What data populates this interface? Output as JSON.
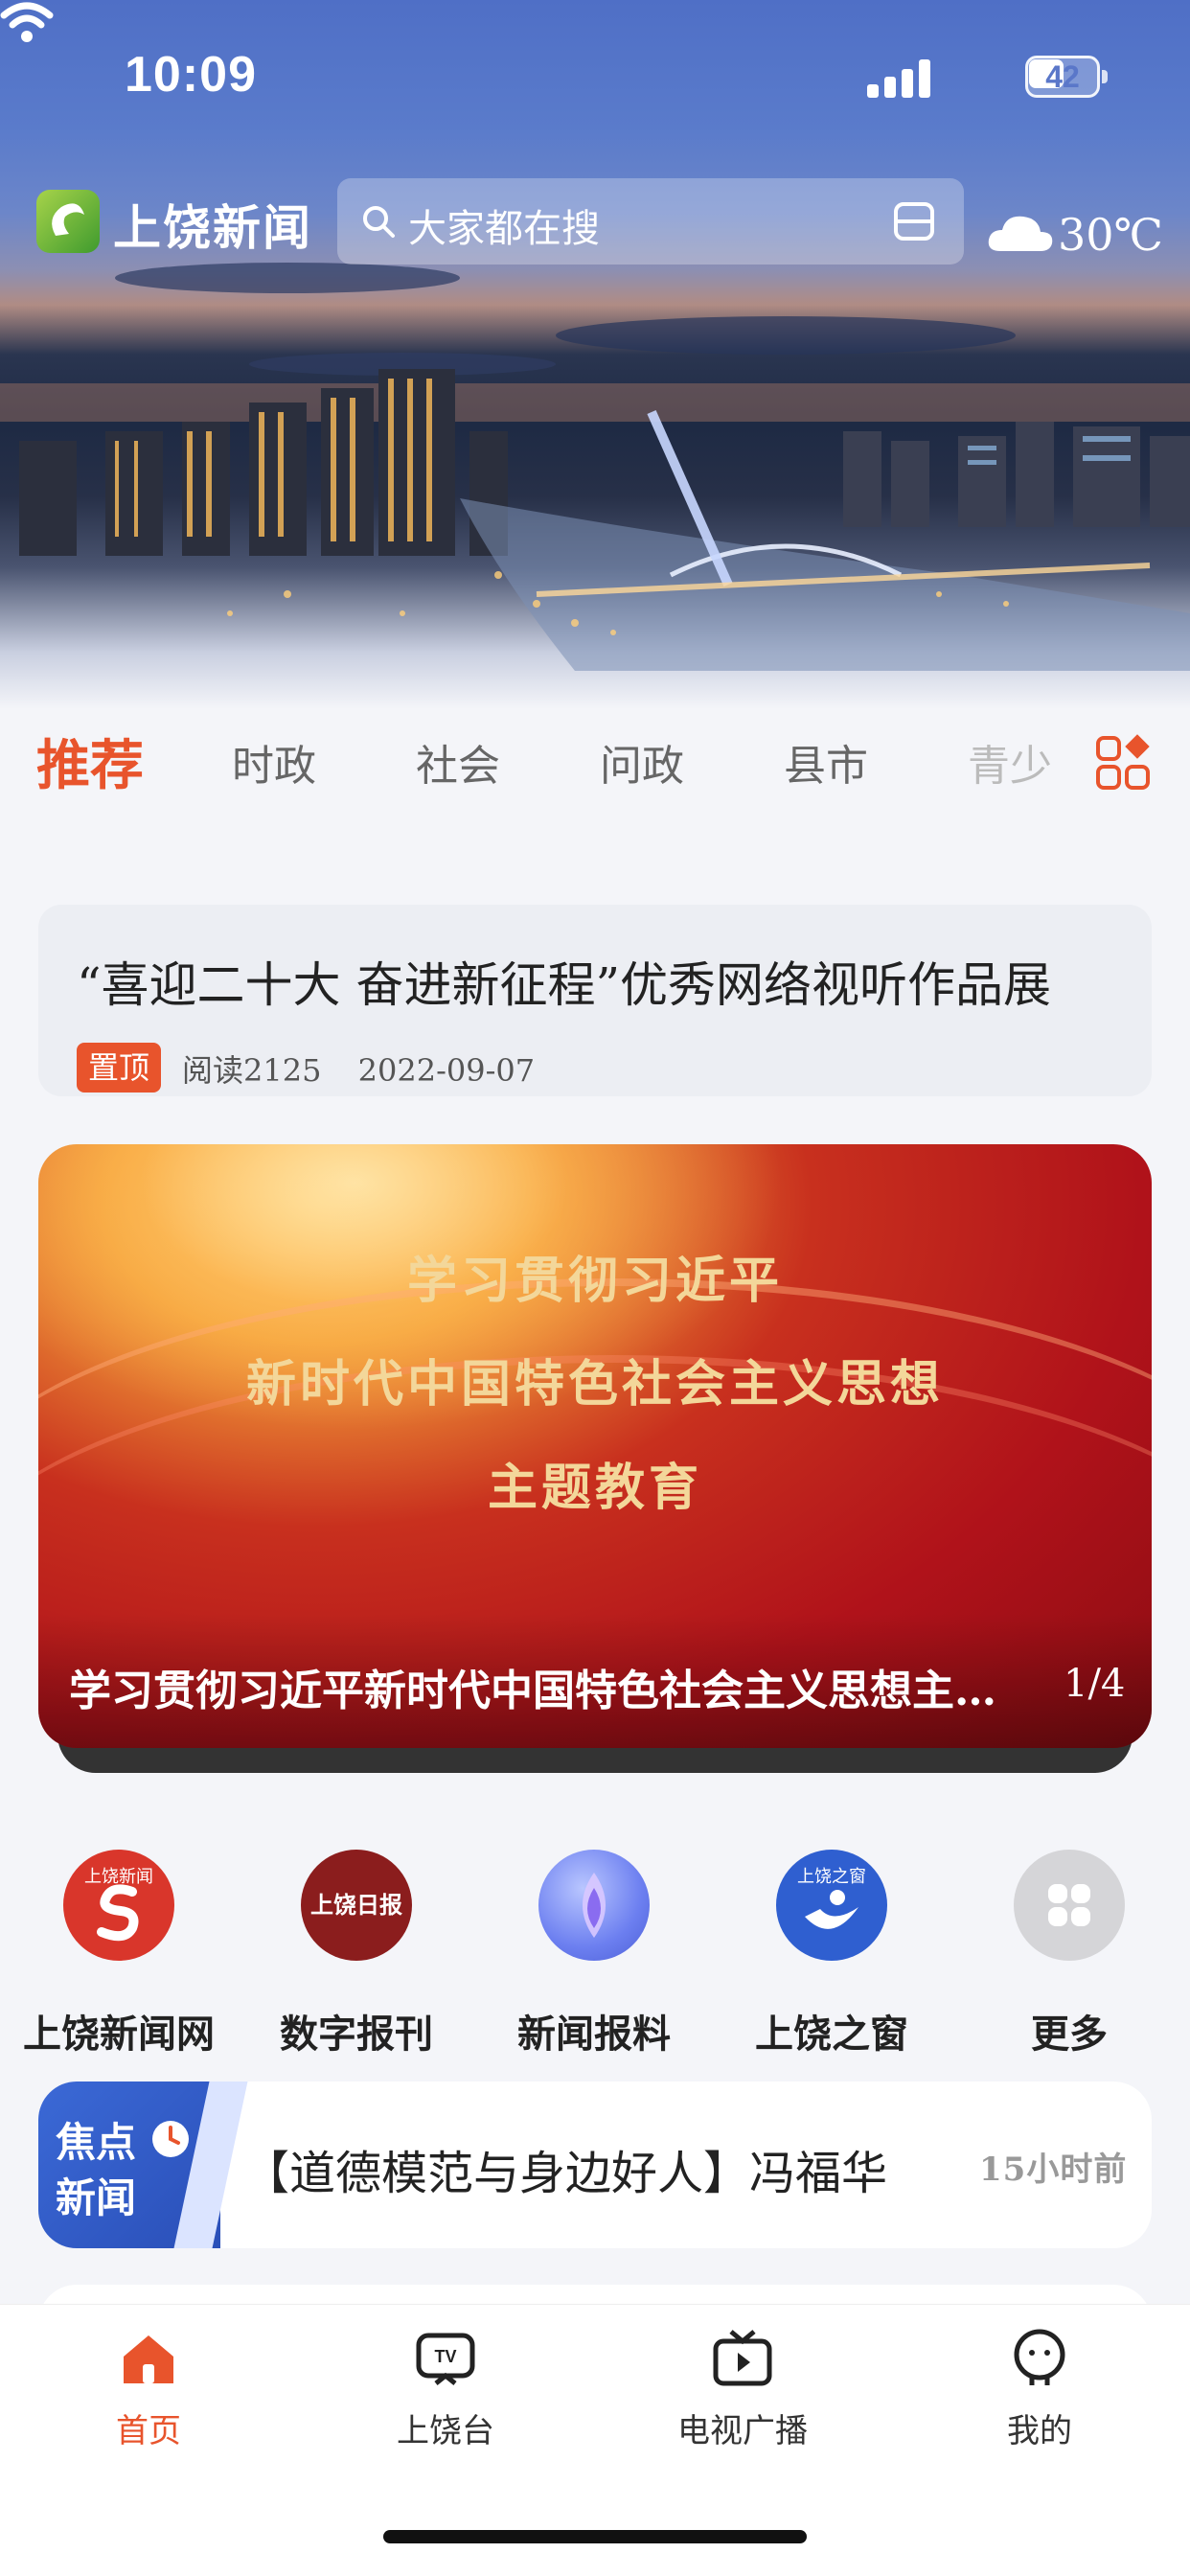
{
  "status_bar": {
    "time": "10:09",
    "battery": "42"
  },
  "header": {
    "app_name": "上饶新闻",
    "search_placeholder": "大家都在搜",
    "weather_temp": "30℃",
    "weather_icon": "cloud-icon"
  },
  "tabs": [
    "推荐",
    "时政",
    "社会",
    "问政",
    "县市",
    "青少"
  ],
  "pinned": {
    "title": "“喜迎二十大 奋进新征程”优秀网络视听作品展",
    "badge": "置顶",
    "reads": "阅读2125",
    "date": "2022-09-07"
  },
  "banner": {
    "line1": "学习贯彻习近平",
    "line2": "新时代中国特色社会主义思想",
    "line3": "主题教育",
    "caption": "学习贯彻习近平新时代中国特色社会主义思想主题教育",
    "pager": "1/4"
  },
  "quick_links": [
    {
      "label": "上饶新闻网",
      "icon": "shangrao-news-logo-icon",
      "color": "#d9362b",
      "logo_text": "上饶新闻"
    },
    {
      "label": "数字报刊",
      "icon": "shangrao-daily-logo-icon",
      "color": "#8b1d1d",
      "logo_text": "上饶日报"
    },
    {
      "label": "新闻报料",
      "icon": "news-tip-icon",
      "color": "#6c7ff0"
    },
    {
      "label": "上饶之窗",
      "icon": "shangrao-window-icon",
      "color": "#2f5fd0",
      "logo_text": "上饶之窗"
    },
    {
      "label": "更多",
      "icon": "more-grid-icon",
      "color": "#d5d5d8"
    }
  ],
  "focus_news": {
    "tag_line1": "焦点",
    "tag_line2": "新闻",
    "title": "【道德模范与身边好人】冯福华",
    "time": "15小时前"
  },
  "bottom_nav": [
    {
      "label": "首页",
      "icon": "home-icon",
      "active": true
    },
    {
      "label": "上饶台",
      "icon": "tv-icon",
      "active": false
    },
    {
      "label": "电视广播",
      "icon": "broadcast-icon",
      "active": false
    },
    {
      "label": "我的",
      "icon": "profile-icon",
      "active": false
    }
  ],
  "colors": {
    "accent": "#e8542c",
    "primary_blue": "#5a7bcb"
  }
}
